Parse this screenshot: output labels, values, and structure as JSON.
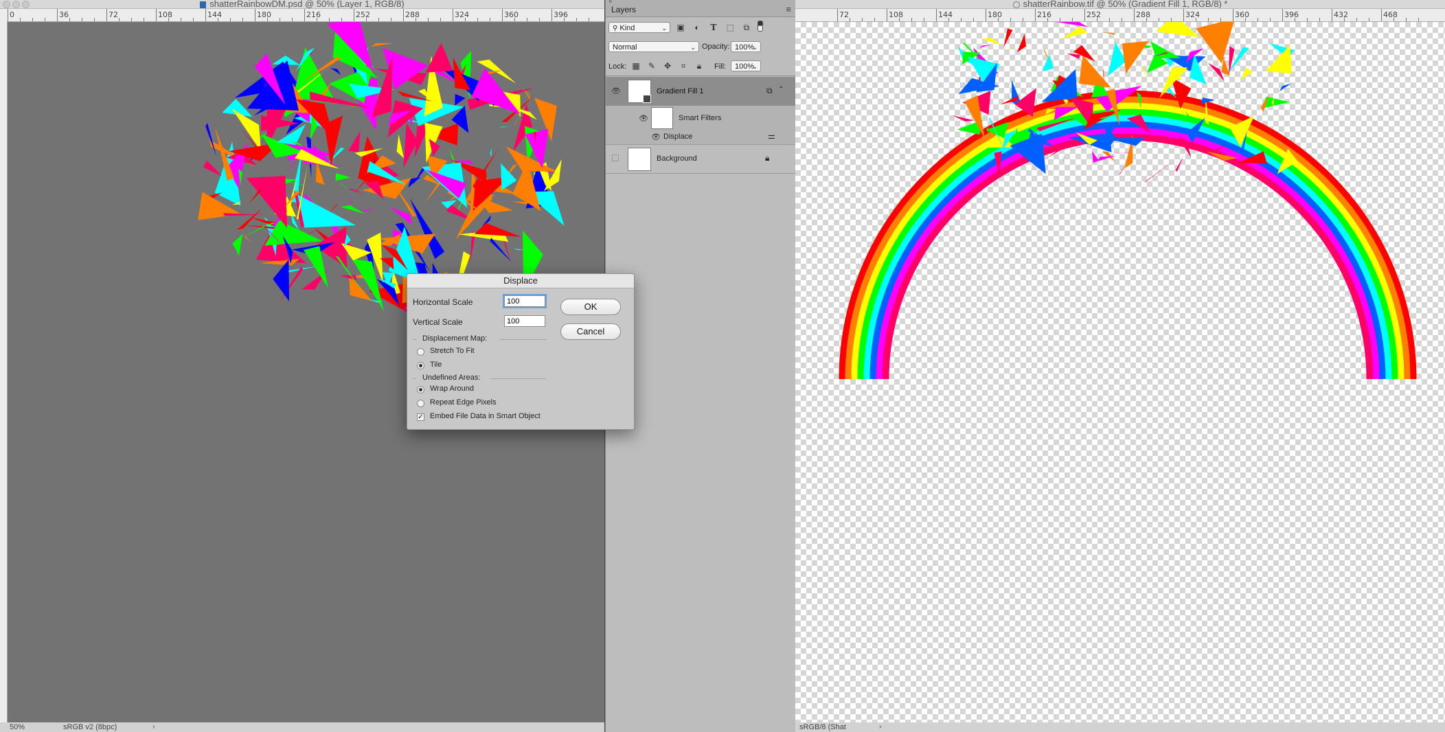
{
  "left_document": {
    "title": "shatterRainbowDM.psd @ 50% (Layer 1, RGB/8)",
    "ruler_labels": [
      "0",
      "36",
      "72",
      "108",
      "144",
      "180",
      "216",
      "252",
      "288",
      "324",
      "360",
      "396"
    ],
    "zoom": "50%",
    "profile": "sRGB v2 (8bpc)"
  },
  "layers_panel": {
    "tab_label": "Layers",
    "filter_kind": "Kind",
    "blend_mode": "Normal",
    "opacity_label": "Opacity:",
    "opacity_value": "100%",
    "lock_label": "Lock:",
    "fill_label": "Fill:",
    "fill_value": "100%",
    "layers": [
      {
        "name": "Gradient Fill 1",
        "selected": true
      },
      {
        "name": "Smart Filters"
      },
      {
        "name": "Displace"
      },
      {
        "name": "Background",
        "locked": true
      }
    ]
  },
  "right_document": {
    "title": "shatterRainbow.tif @ 50% (Gradient Fill 1, RGB/8) *",
    "ruler_labels": [
      "72",
      "108",
      "144",
      "180",
      "216",
      "252",
      "288",
      "324",
      "360",
      "396",
      "432",
      "468"
    ],
    "profile": "sRGB/8 (Shat"
  },
  "dialog": {
    "title": "Displace",
    "horizontal_scale_label": "Horizontal Scale",
    "horizontal_scale_value": "100",
    "vertical_scale_label": "Vertical Scale",
    "vertical_scale_value": "100",
    "ok_label": "OK",
    "cancel_label": "Cancel",
    "displacement_map_label": "Displacement Map:",
    "stretch_label": "Stretch To Fit",
    "tile_label": "Tile",
    "undefined_areas_label": "Undefined Areas:",
    "wrap_label": "Wrap Around",
    "repeat_label": "Repeat Edge Pixels",
    "embed_label": "Embed File Data in Smart Object",
    "selected_map": "Tile",
    "selected_undefined": "Wrap Around",
    "embed_checked": true
  },
  "colors": {
    "canvas_gray": "#737373",
    "focus_blue": "#6aa0e0",
    "rainbow": [
      "#ff0000",
      "#ff7f00",
      "#ffff00",
      "#00ff00",
      "#00ffff",
      "#0000ff",
      "#ff00ff",
      "#ff0066"
    ]
  }
}
